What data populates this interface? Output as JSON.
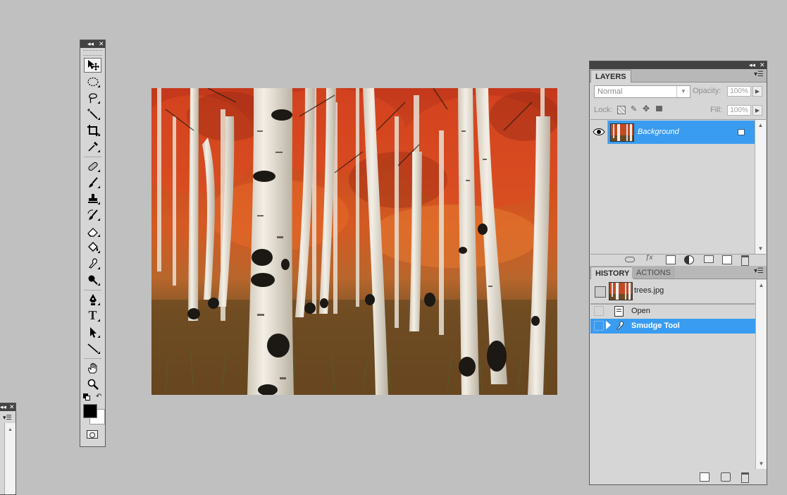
{
  "colors": {
    "workspace": "#c0c0c0",
    "panel": "#d6d6d6",
    "titlebar": "#424242",
    "selection": "#3a9cf0"
  },
  "window_controls": {
    "collapse": "◂◂",
    "close": "✕"
  },
  "tools": [
    {
      "icon": "move-tool-icon"
    },
    {
      "icon": "elliptical-marquee-icon"
    },
    {
      "icon": "lasso-icon"
    },
    {
      "icon": "magic-wand-icon"
    },
    {
      "icon": "crop-icon"
    },
    {
      "icon": "eyedropper-icon"
    },
    {
      "icon": "healing-brush-icon"
    },
    {
      "icon": "brush-icon"
    },
    {
      "icon": "clone-stamp-icon"
    },
    {
      "icon": "history-brush-icon"
    },
    {
      "icon": "eraser-icon"
    },
    {
      "icon": "paint-bucket-icon"
    },
    {
      "icon": "smudge-icon"
    },
    {
      "icon": "dodge-icon"
    },
    {
      "icon": "pen-icon"
    },
    {
      "icon": "type-icon",
      "glyph": "T"
    },
    {
      "icon": "path-selection-icon"
    },
    {
      "icon": "line-icon"
    },
    {
      "icon": "hand-icon"
    },
    {
      "icon": "zoom-icon"
    }
  ],
  "layers_panel": {
    "tab": "LAYERS",
    "menu_glyph": "▾☰",
    "blend_mode": "Normal",
    "opacity_label": "Opacity:",
    "opacity_value": "100%",
    "lock_label": "Lock:",
    "fill_label": "Fill:",
    "fill_value": "100%",
    "layers": [
      {
        "name": "Background",
        "visible": true,
        "locked": true,
        "selected": true
      }
    ]
  },
  "history_panel": {
    "tabs": [
      "HISTORY",
      "ACTIONS"
    ],
    "snapshot": "trees.jpg",
    "states": [
      {
        "label": "Open",
        "icon": "document-icon",
        "selected": false
      },
      {
        "label": "Smudge Tool",
        "icon": "smudge-icon",
        "selected": true
      }
    ]
  }
}
